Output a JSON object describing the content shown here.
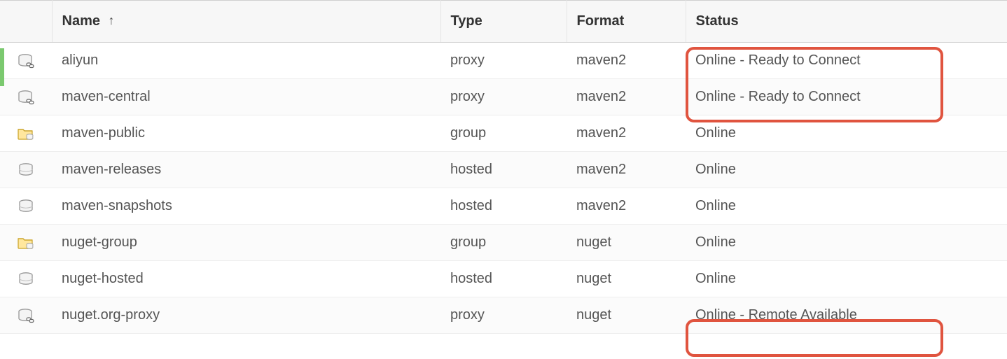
{
  "columns": {
    "name": "Name",
    "type": "Type",
    "format": "Format",
    "status": "Status"
  },
  "sort": {
    "column": "name",
    "direction_glyph": "↑"
  },
  "rows": [
    {
      "icon": "proxy-icon",
      "name": "aliyun",
      "type": "proxy",
      "format": "maven2",
      "status": "Online - Ready to Connect"
    },
    {
      "icon": "proxy-icon",
      "name": "maven-central",
      "type": "proxy",
      "format": "maven2",
      "status": "Online - Ready to Connect"
    },
    {
      "icon": "group-icon",
      "name": "maven-public",
      "type": "group",
      "format": "maven2",
      "status": "Online"
    },
    {
      "icon": "hosted-icon",
      "name": "maven-releases",
      "type": "hosted",
      "format": "maven2",
      "status": "Online"
    },
    {
      "icon": "hosted-icon",
      "name": "maven-snapshots",
      "type": "hosted",
      "format": "maven2",
      "status": "Online"
    },
    {
      "icon": "group-icon",
      "name": "nuget-group",
      "type": "group",
      "format": "nuget",
      "status": "Online"
    },
    {
      "icon": "hosted-icon",
      "name": "nuget-hosted",
      "type": "hosted",
      "format": "nuget",
      "status": "Online"
    },
    {
      "icon": "proxy-icon",
      "name": "nuget.org-proxy",
      "type": "proxy",
      "format": "nuget",
      "status": "Online - Remote Available"
    }
  ],
  "colors": {
    "annotation": "#e0543f",
    "accent": "#7bc96f"
  }
}
